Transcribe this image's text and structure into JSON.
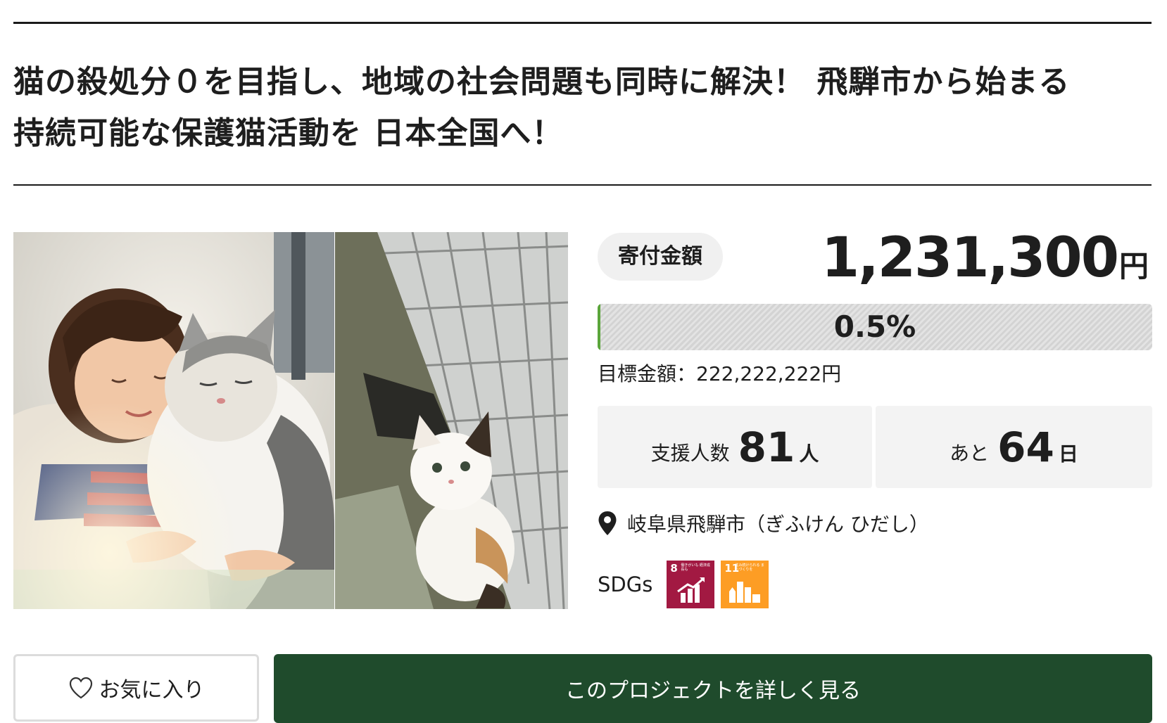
{
  "project": {
    "title_line1": "猫の殺処分０を目指し、地域の社会問題も同時に解決！ 飛騨市から始まる",
    "title_line2": "持続可能な保護猫活動を 日本全国へ！"
  },
  "donation": {
    "badge_label": "寄付金額",
    "amount": "1,231,300",
    "amount_unit": "円",
    "progress_percent": 0.5,
    "progress_label": "0.5%",
    "goal_text": "目標金額：222,222,222円",
    "progress_fill_color": "#5aa53a"
  },
  "stats": {
    "supporters_label": "支援人数",
    "supporters_value": "81",
    "supporters_unit": "人",
    "remaining_label": "あと",
    "remaining_value": "64",
    "remaining_unit": "日"
  },
  "location": {
    "icon": "map-pin-icon",
    "text": "岐阜県飛騨市（ぎふけん ひだし）"
  },
  "sdgs": {
    "label": "SDGs",
    "goals": [
      {
        "number": "8",
        "caption": "働きがいも 経済成長も",
        "color": "#a21942",
        "icon": "growth-chart-icon"
      },
      {
        "number": "11",
        "caption": "住み続けられる まちづくりを",
        "color": "#fd9d24",
        "icon": "city-buildings-icon"
      }
    ]
  },
  "buttons": {
    "favorite_label": "お気に入り",
    "favorite_icon": "heart-outline-icon",
    "details_label": "このプロジェクトを詳しく見る",
    "details_color": "#1f4b2c"
  }
}
